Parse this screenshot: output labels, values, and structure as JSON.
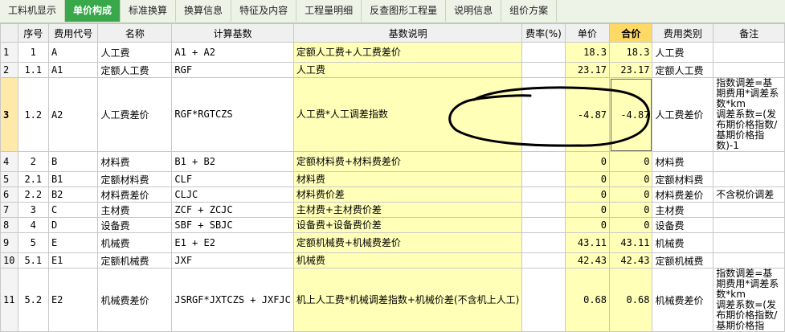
{
  "tabs": [
    {
      "label": "工料机显示",
      "active": false
    },
    {
      "label": "单价构成",
      "active": true
    },
    {
      "label": "标准换算",
      "active": false
    },
    {
      "label": "换算信息",
      "active": false
    },
    {
      "label": "特征及内容",
      "active": false
    },
    {
      "label": "工程量明细",
      "active": false
    },
    {
      "label": "反查图形工程量",
      "active": false
    },
    {
      "label": "说明信息",
      "active": false
    },
    {
      "label": "组价方案",
      "active": false
    }
  ],
  "columns": {
    "seq": "序号",
    "code": "费用代号",
    "name": "名称",
    "base": "计算基数",
    "base_desc": "基数说明",
    "rate": "费率(%)",
    "unit_price": "单价",
    "total": "合价",
    "category": "费用类别",
    "remark": "备注"
  },
  "rows": [
    {
      "row": "1",
      "seq": "1",
      "code": "A",
      "name": "人工费",
      "base": "A1 + A2",
      "base_desc": "定额人工费+人工费差价",
      "rate": "",
      "unit_price": "18.3",
      "total": "18.3",
      "category": "人工费",
      "remark": ""
    },
    {
      "row": "2",
      "seq": "1.1",
      "code": "A1",
      "name": "定额人工费",
      "base": "RGF",
      "base_desc": "人工费",
      "rate": "",
      "unit_price": "23.17",
      "total": "23.17",
      "category": "定额人工费",
      "remark": ""
    },
    {
      "row": "3",
      "seq": "1.2",
      "code": "A2",
      "name": "人工费差价",
      "base": "RGF*RGTCZS",
      "base_desc": "人工费*人工调差指数",
      "rate": "",
      "unit_price": "-4.87",
      "total": "-4.87",
      "category": "人工费差价",
      "remark": "指数调差=基期费用*调差系数*km\n调差系数=(发布期价格指数/基期价格指数)-1"
    },
    {
      "row": "4",
      "seq": "2",
      "code": "B",
      "name": "材料费",
      "base": "B1 + B2",
      "base_desc": "定额材料费+材料费差价",
      "rate": "",
      "unit_price": "0",
      "total": "0",
      "category": "材料费",
      "remark": ""
    },
    {
      "row": "5",
      "seq": "2.1",
      "code": "B1",
      "name": "定额材料费",
      "base": "CLF",
      "base_desc": "材料费",
      "rate": "",
      "unit_price": "0",
      "total": "0",
      "category": "定额材料费",
      "remark": ""
    },
    {
      "row": "6",
      "seq": "2.2",
      "code": "B2",
      "name": "材料费差价",
      "base": "CLJC",
      "base_desc": "材料费价差",
      "rate": "",
      "unit_price": "0",
      "total": "0",
      "category": "材料费差价",
      "remark": "不含税价调差"
    },
    {
      "row": "7",
      "seq": "3",
      "code": "C",
      "name": "主材费",
      "base": "ZCF + ZCJC",
      "base_desc": "主材费+主材费价差",
      "rate": "",
      "unit_price": "0",
      "total": "0",
      "category": "主材费",
      "remark": ""
    },
    {
      "row": "8",
      "seq": "4",
      "code": "D",
      "name": "设备费",
      "base": "SBF + SBJC",
      "base_desc": "设备费+设备费价差",
      "rate": "",
      "unit_price": "0",
      "total": "0",
      "category": "设备费",
      "remark": ""
    },
    {
      "row": "9",
      "seq": "5",
      "code": "E",
      "name": "机械费",
      "base": "E1 + E2",
      "base_desc": "定额机械费+机械费差价",
      "rate": "",
      "unit_price": "43.11",
      "total": "43.11",
      "category": "机械费",
      "remark": ""
    },
    {
      "row": "10",
      "seq": "5.1",
      "code": "E1",
      "name": "定额机械费",
      "base": "JXF",
      "base_desc": "机械费",
      "rate": "",
      "unit_price": "42.43",
      "total": "42.43",
      "category": "定额机械费",
      "remark": ""
    },
    {
      "row": "11",
      "seq": "5.2",
      "code": "E2",
      "name": "机械费差价",
      "base": "JSRGF*JXTCZS + JXFJC",
      "base_desc": "机上人工费*机械调差指数+机械价差(不含机上人工)",
      "rate": "",
      "unit_price": "0.68",
      "total": "0.68",
      "category": "机械费差价",
      "remark": "指数调差=基期费用*调差系数*km\n调差系数=(发布期价格指数/基期价格指"
    }
  ],
  "current_row": 2
}
